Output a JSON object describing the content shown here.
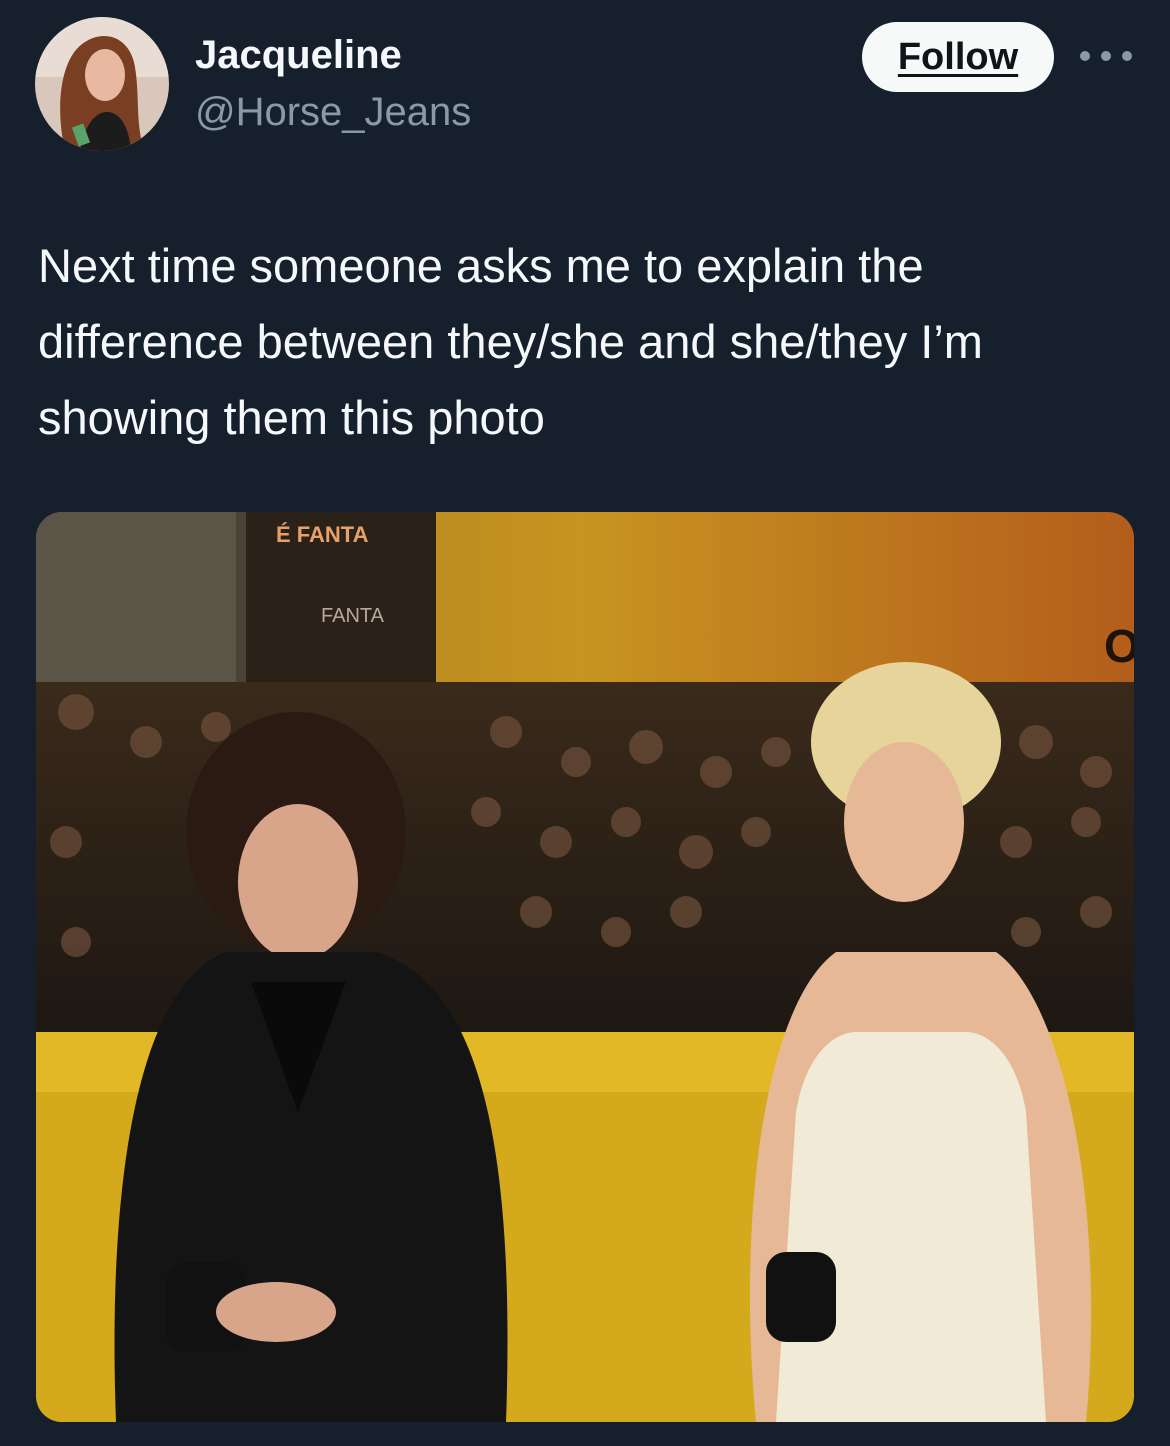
{
  "author": {
    "display_name": "Jacqueline",
    "handle": "@Horse_Jeans",
    "avatar_icon": "profile-photo"
  },
  "actions": {
    "follow_label": "Follow",
    "more_icon": "ellipsis-icon"
  },
  "tweet": {
    "text": "Next time someone asks me to explain the difference between they/she and she/they I’m showing them this photo"
  },
  "media": {
    "sign_top": "É FANTA",
    "sign_logo": "FANTA",
    "wall_letter": "O"
  },
  "colors": {
    "background": "#16202c",
    "primary_text": "#f5f8fa",
    "secondary_text": "#8b98a5",
    "button_bg": "#f7f9f9"
  }
}
